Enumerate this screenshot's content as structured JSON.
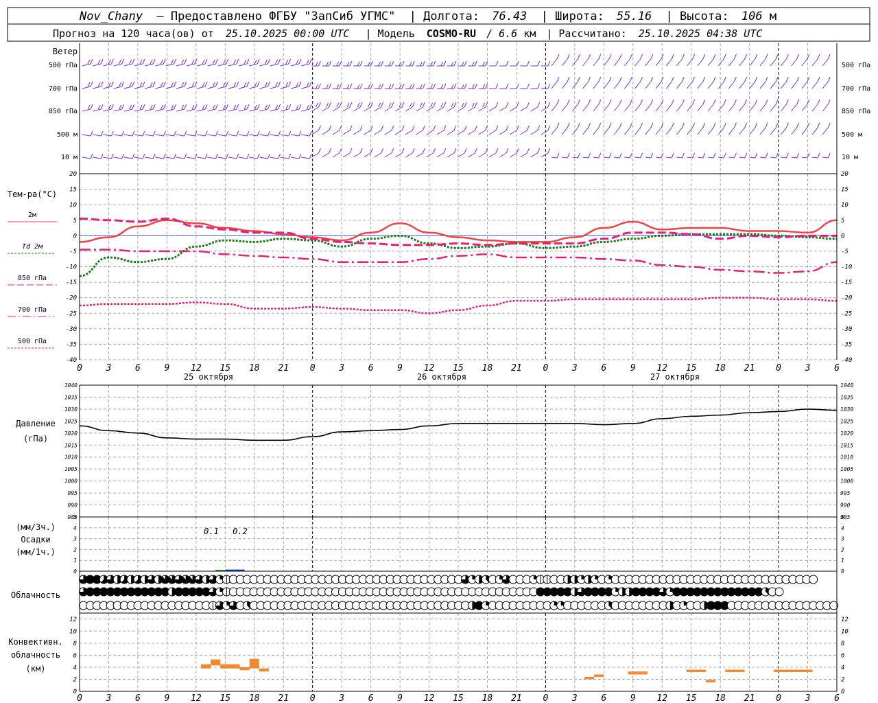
{
  "header": {
    "station": "Nov_Chany",
    "provider": "— Предоставлено ФГБУ \"ЗапСиб УГМС\"",
    "lon_label": "| Долгота:",
    "lon": "76.43",
    "lat_label": "| Широта:",
    "lat": "55.16",
    "alt_label": "| Высота:",
    "alt": "106",
    "alt_unit": "м",
    "forecast_label": "Прогноз на 120 часа(ов) от",
    "run_time": "25.10.2025 00:00 UTC",
    "model_label": "| Модель",
    "model": "COSMO-RU",
    "model_res": "/ 6.6",
    "model_res_unit": "км",
    "calc_label": "| Рассчитано:",
    "calc_time": "25.10.2025 04:38 UTC"
  },
  "labels": {
    "wind": "Ветер",
    "wind_levels": [
      "500 гПа",
      "700 гПа",
      "850 гПа",
      "500 м",
      "10 м"
    ],
    "temp": "Тем-ра(°C)",
    "temp_legend": [
      "2м",
      "Td 2м",
      "850 гПа",
      "700 гПа",
      "500 гПа"
    ],
    "pressure": "Давление",
    "pressure_unit": "(гПа)",
    "precip_unit_3h": "(мм/3ч.)",
    "precip": "Осадки",
    "precip_unit_1h": "(мм/1ч.)",
    "cloud": "Облачность",
    "conv_1": "Конвективн.",
    "conv_2": "облачность",
    "conv_3": "(км)",
    "dates": [
      "25 октября",
      "26 октября",
      "27 октября"
    ],
    "precip_values": [
      "0.1",
      "0.2"
    ]
  },
  "colors": {
    "wind": "#7a2ed6",
    "t2m": "#ee4444",
    "td2m": "#167a16",
    "t850": "#e0207a",
    "t700": "#e0207a",
    "t500": "#e0207a",
    "pressure": "#000000",
    "convective": "#f08a30",
    "precip_rain": "#2040d0",
    "precip_light": "#30a030",
    "grid": "#a8a8a8"
  },
  "chart_data": [
    {
      "type": "line",
      "title": "Тем-ра(°C)",
      "x_hours": [
        0,
        3,
        6,
        9,
        12,
        15,
        18,
        21,
        24,
        27,
        30,
        33,
        36,
        39,
        42,
        45,
        48,
        51,
        54,
        57,
        60,
        63,
        66,
        69,
        72,
        75,
        78
      ],
      "xticks": [
        "0",
        "3",
        "6",
        "9",
        "12",
        "15",
        "18",
        "21",
        "0",
        "3",
        "6",
        "9",
        "12",
        "15",
        "18",
        "21",
        "0",
        "3",
        "6",
        "9",
        "12",
        "15",
        "18",
        "21",
        "0",
        "3",
        "6"
      ],
      "ylim": [
        -40,
        20
      ],
      "yticks": [
        20,
        15,
        10,
        5,
        0,
        -5,
        -10,
        -15,
        -20,
        -25,
        -30,
        -35,
        -40
      ],
      "series": [
        {
          "name": "2м",
          "style": "solid",
          "values": [
            -2,
            -0.5,
            3,
            5,
            4,
            2.5,
            1.5,
            0.5,
            -0.5,
            -1.5,
            1,
            4,
            1,
            -0.5,
            -1.5,
            -2,
            -2,
            -0.5,
            2.5,
            4.5,
            2,
            2.5,
            2.5,
            1.5,
            1.5,
            1,
            5
          ]
        },
        {
          "name": "Td 2м",
          "style": "dotted",
          "values": [
            -13,
            -7,
            -8.5,
            -7.5,
            -3.5,
            -1.5,
            -2,
            -1,
            -1.5,
            -3.5,
            -1,
            0,
            -2.5,
            -4,
            -3.5,
            -2.5,
            -4,
            -3.5,
            -2,
            -1,
            0,
            0.5,
            0.5,
            0.5,
            0,
            -0.5,
            -1
          ]
        },
        {
          "name": "850 гПа",
          "style": "dashed",
          "values": [
            5.5,
            5,
            4.5,
            5.5,
            3,
            2,
            1,
            1,
            -1,
            -2,
            -2.5,
            -3,
            -3,
            -2.5,
            -3,
            -2.5,
            -2.5,
            -2.5,
            -1,
            1,
            1,
            0.5,
            -1,
            0,
            -0.5,
            0,
            0
          ]
        },
        {
          "name": "700 гПа",
          "style": "dashdot",
          "values": [
            -4.5,
            -4.5,
            -5,
            -5,
            -5,
            -6,
            -6.5,
            -7,
            -7.5,
            -8.5,
            -8.5,
            -8.5,
            -7.5,
            -6.5,
            -6,
            -7,
            -7,
            -7,
            -7.5,
            -8,
            -9.5,
            -10,
            -11,
            -11.5,
            -12,
            -11.5,
            -8.5
          ]
        },
        {
          "name": "500 гПа",
          "style": "dotted",
          "values": [
            -22.5,
            -22,
            -22,
            -22,
            -21.5,
            -22,
            -23.5,
            -23.5,
            -23,
            -23.5,
            -24,
            -24,
            -25,
            -24,
            -22.5,
            -21,
            -21,
            -20.5,
            -20.5,
            -20.5,
            -20.5,
            -20.5,
            -20,
            -20,
            -20.5,
            -20.5,
            -21
          ]
        }
      ]
    },
    {
      "type": "line",
      "title": "Давление",
      "ylabel": "(гПа)",
      "x_hours": [
        0,
        3,
        6,
        9,
        12,
        15,
        18,
        21,
        24,
        27,
        30,
        33,
        36,
        39,
        42,
        45,
        48,
        51,
        54,
        57,
        60,
        63,
        66,
        69,
        72,
        75,
        78
      ],
      "ylim": [
        985,
        1040
      ],
      "yticks": [
        1040,
        1035,
        1030,
        1025,
        1020,
        1015,
        1010,
        1005,
        1000,
        995,
        990,
        985
      ],
      "series": [
        {
          "name": "Давление",
          "values": [
            1023,
            1021,
            1020,
            1018,
            1017.5,
            1017.5,
            1017,
            1017,
            1018.5,
            1020.5,
            1021,
            1021.5,
            1023,
            1024,
            1024,
            1024,
            1024,
            1024,
            1023.5,
            1024,
            1026,
            1027,
            1027.5,
            1028.5,
            1029,
            1030,
            1029.5
          ]
        }
      ]
    },
    {
      "type": "bar",
      "title": "Осадки",
      "ylabel": "(мм/3ч.)",
      "ylim": [
        0,
        5
      ],
      "yticks": [
        5,
        4,
        3,
        2,
        1,
        0
      ],
      "data_labels": [
        {
          "hour": 14,
          "text": "0.1"
        },
        {
          "hour": 17,
          "text": "0.2"
        }
      ],
      "bars": [
        {
          "hour_start": 14,
          "hour_end": 15,
          "value": 0.05,
          "kind": "light"
        },
        {
          "hour_start": 15,
          "hour_end": 17,
          "value": 0.15,
          "kind": "rain"
        }
      ]
    },
    {
      "type": "table",
      "title": "Облачность",
      "note": "cloud cover in oktas per 1-hour step, three rows (upper, middle, lower)",
      "rows": [
        [
          6,
          8,
          8,
          5,
          6,
          4,
          5,
          4,
          5,
          4,
          6,
          4,
          7,
          7,
          6,
          7,
          7,
          6,
          4,
          6,
          2,
          1,
          0,
          0,
          0,
          0,
          0,
          0,
          0,
          0,
          0,
          0,
          0,
          0,
          0,
          0,
          0,
          0,
          0,
          0,
          0,
          0,
          0,
          0,
          0,
          0,
          0,
          0,
          0,
          0,
          0,
          0,
          0,
          0,
          0,
          0,
          6,
          2,
          4,
          3,
          0,
          2,
          6,
          0,
          0,
          0,
          2,
          1,
          1,
          0,
          0,
          4,
          4,
          2,
          4,
          2,
          0,
          2,
          0,
          0,
          0,
          0,
          0,
          0,
          0,
          0,
          0,
          0,
          0,
          0,
          0,
          0,
          0,
          0,
          0,
          0,
          0,
          0,
          0,
          0,
          0,
          0,
          0,
          0,
          0,
          0,
          0,
          0
        ],
        [
          6,
          8,
          8,
          8,
          8,
          8,
          8,
          8,
          8,
          8,
          8,
          8,
          8,
          4,
          8,
          8,
          8,
          8,
          8,
          6,
          2,
          1,
          0,
          0,
          0,
          0,
          0,
          0,
          0,
          0,
          0,
          0,
          0,
          0,
          0,
          0,
          0,
          0,
          0,
          0,
          0,
          0,
          0,
          0,
          0,
          0,
          0,
          0,
          0,
          0,
          0,
          0,
          0,
          0,
          0,
          0,
          0,
          0,
          0,
          0,
          0,
          0,
          0,
          0,
          0,
          0,
          0,
          8,
          8,
          8,
          8,
          8,
          4,
          6,
          8,
          8,
          8,
          8,
          2,
          4,
          4,
          8,
          8,
          8,
          8,
          6,
          2,
          8,
          8,
          8,
          8,
          8,
          8,
          8,
          8,
          8,
          8,
          8,
          8,
          8,
          3,
          0,
          0
        ],
        [
          0,
          0,
          0,
          0,
          0,
          0,
          0,
          0,
          0,
          0,
          0,
          0,
          0,
          0,
          0,
          0,
          0,
          0,
          0,
          1,
          6,
          2,
          6,
          0,
          3,
          0,
          0,
          0,
          0,
          0,
          0,
          0,
          0,
          0,
          0,
          0,
          0,
          0,
          0,
          0,
          0,
          0,
          0,
          0,
          0,
          0,
          0,
          0,
          0,
          0,
          0,
          0,
          0,
          0,
          0,
          0,
          0,
          4,
          8,
          2,
          0,
          0,
          0,
          0,
          0,
          0,
          0,
          0,
          0,
          2,
          2,
          0,
          0,
          0,
          0,
          0,
          0,
          3,
          0,
          0,
          0,
          0,
          0,
          0,
          0,
          0,
          4,
          0,
          2,
          0,
          0,
          4,
          8,
          8,
          8,
          0,
          0,
          0,
          0,
          0,
          0,
          0,
          0,
          0,
          0,
          0,
          0,
          0,
          0,
          0,
          0,
          0
        ]
      ]
    },
    {
      "type": "bar",
      "title": "Конвективн. облачность",
      "ylabel": "(км)",
      "ylim": [
        0,
        13
      ],
      "yticks": [
        12,
        10,
        8,
        6,
        4,
        2,
        0
      ],
      "segments": [
        {
          "h0": 12.5,
          "h1": 13.5,
          "bottom": 3.8,
          "top": 4.5
        },
        {
          "h0": 13.5,
          "h1": 14.5,
          "bottom": 4.3,
          "top": 5.3
        },
        {
          "h0": 14.5,
          "h1": 16.5,
          "bottom": 3.8,
          "top": 4.5
        },
        {
          "h0": 16.5,
          "h1": 17.5,
          "bottom": 3.5,
          "top": 4.0
        },
        {
          "h0": 17.5,
          "h1": 18.5,
          "bottom": 3.8,
          "top": 5.4
        },
        {
          "h0": 18.5,
          "h1": 19.5,
          "bottom": 3.3,
          "top": 3.8
        },
        {
          "h0": 52.0,
          "h1": 53.0,
          "bottom": 2.0,
          "top": 2.4
        },
        {
          "h0": 53.0,
          "h1": 54.0,
          "bottom": 2.4,
          "top": 2.8
        },
        {
          "h0": 56.5,
          "h1": 58.5,
          "bottom": 2.8,
          "top": 3.3
        },
        {
          "h0": 62.5,
          "h1": 64.5,
          "bottom": 3.2,
          "top": 3.6
        },
        {
          "h0": 64.5,
          "h1": 65.5,
          "bottom": 1.5,
          "top": 1.9
        },
        {
          "h0": 66.5,
          "h1": 68.5,
          "bottom": 3.2,
          "top": 3.6
        },
        {
          "h0": 71.5,
          "h1": 75.5,
          "bottom": 3.2,
          "top": 3.6
        }
      ]
    }
  ]
}
